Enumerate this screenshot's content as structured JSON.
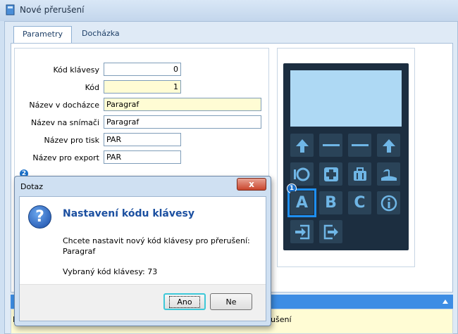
{
  "window": {
    "title": "Nové přerušení"
  },
  "tabs": [
    {
      "label": "Parametry"
    },
    {
      "label": "Docházka"
    }
  ],
  "form": {
    "fields": [
      {
        "label": "Kód klávesy",
        "value": "0"
      },
      {
        "label": "Kód",
        "value": "1"
      },
      {
        "label": "Název v docházce",
        "value": "Paragraf"
      },
      {
        "label": "Název na snímači",
        "value": "Paragraf"
      },
      {
        "label": "Název pro tisk",
        "value": "PAR"
      },
      {
        "label": "Název pro export",
        "value": "PAR"
      }
    ]
  },
  "device": {
    "keys_row3": [
      "A",
      "B",
      "C"
    ],
    "badge_selected": "1",
    "colors": {
      "body": "#1c2e40",
      "screen": "#aed9f4",
      "key": "#2a4358",
      "icon": "#6fb6e6",
      "selection": "#1e8ff0"
    }
  },
  "bottom": {
    "partial_text_left": "K",
    "partial_text_right": "ušení"
  },
  "dialog": {
    "badge": "2",
    "title": "Dotaz",
    "close_label": "x",
    "heading": "Nastavení kódu klávesy",
    "message_line1": "Chcete nastavit nový kód klávesy pro přerušení:",
    "message_line2": "Paragraf",
    "selected_code": "Vybraný kód klávesy: 73",
    "buttons": {
      "yes": "Ano",
      "no": "Ne"
    }
  }
}
